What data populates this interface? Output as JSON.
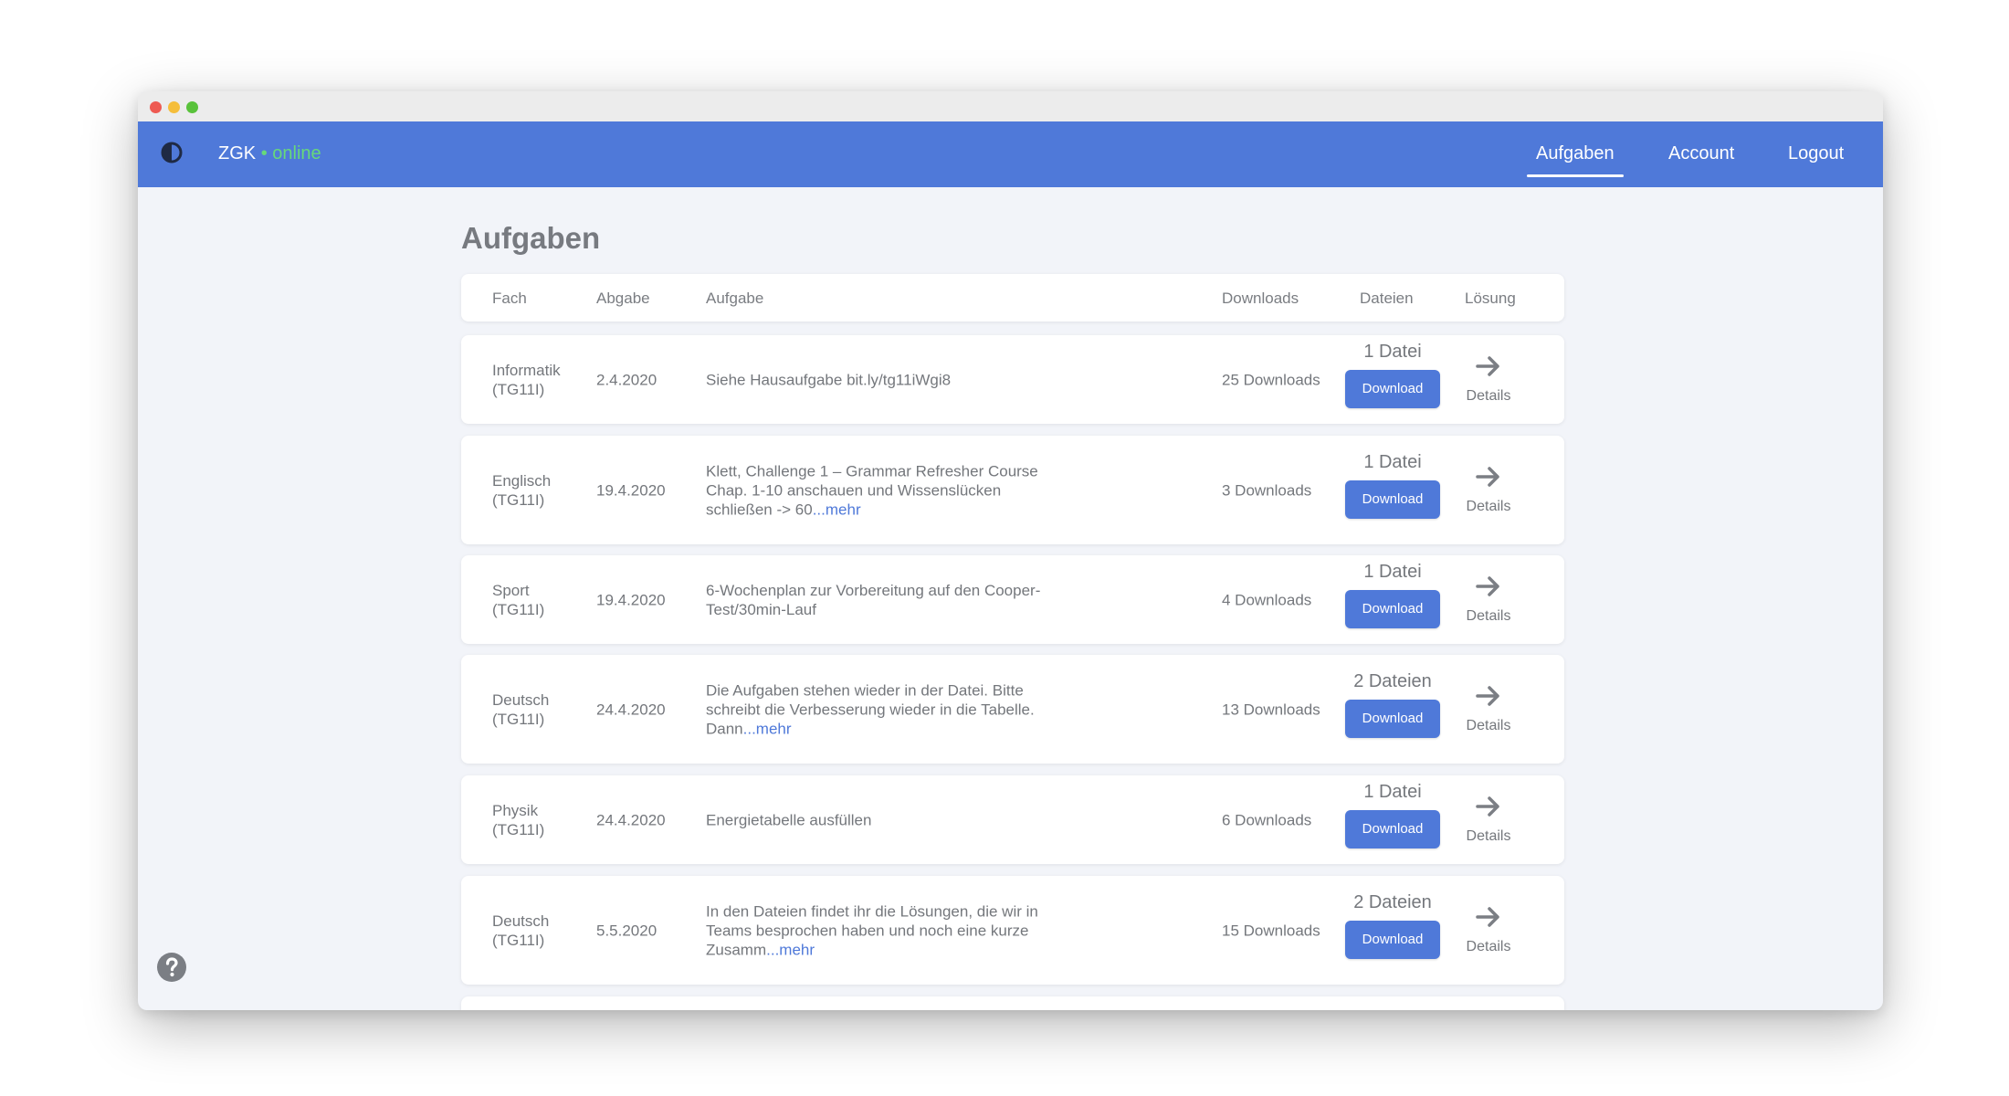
{
  "brand": {
    "name": "ZGK",
    "separator": "•",
    "status": "online"
  },
  "nav": {
    "items": [
      {
        "label": "Aufgaben"
      },
      {
        "label": "Account"
      },
      {
        "label": "Logout"
      }
    ],
    "active": "Aufgaben"
  },
  "page": {
    "title": "Aufgaben"
  },
  "table": {
    "headers": {
      "fach": "Fach",
      "abgabe": "Abgabe",
      "aufgabe": "Aufgabe",
      "downloads": "Downloads",
      "dateien": "Dateien",
      "loesung": "Lösung"
    },
    "rows": [
      {
        "fach": "Informatik",
        "klasse": "(TG11I)",
        "abgabe": "2.4.2020",
        "aufgabe": "Siehe Hausaufgabe bit.ly/tg11iWgi8",
        "mehr": "",
        "downloads": "25 Downloads",
        "dateien": "1 Datei",
        "button": "Download",
        "details": "Details"
      },
      {
        "fach": "Englisch",
        "klasse": "(TG11I)",
        "abgabe": "19.4.2020",
        "aufgabe": "Klett, Challenge 1 – Grammar Refresher Course Chap. 1-10 anschauen und Wissenslücken schließen -> 60",
        "mehr": "...mehr",
        "downloads": "3 Downloads",
        "dateien": "1 Datei",
        "button": "Download",
        "details": "Details"
      },
      {
        "fach": "Sport",
        "klasse": "(TG11I)",
        "abgabe": "19.4.2020",
        "aufgabe": "6-Wochenplan zur Vorbereitung auf den Cooper-Test/30min-Lauf",
        "mehr": "",
        "downloads": "4 Downloads",
        "dateien": "1 Datei",
        "button": "Download",
        "details": "Details"
      },
      {
        "fach": "Deutsch",
        "klasse": "(TG11I)",
        "abgabe": "24.4.2020",
        "aufgabe": "Die Aufgaben stehen wieder in der Datei. Bitte schreibt die Verbesserung wieder in die Tabelle. Dann",
        "mehr": "...mehr",
        "downloads": "13 Downloads",
        "dateien": "2 Dateien",
        "button": "Download",
        "details": "Details"
      },
      {
        "fach": "Physik",
        "klasse": "(TG11I)",
        "abgabe": "24.4.2020",
        "aufgabe": "Energietabelle ausfüllen",
        "mehr": "",
        "downloads": "6 Downloads",
        "dateien": "1 Datei",
        "button": "Download",
        "details": "Details"
      },
      {
        "fach": "Deutsch",
        "klasse": "(TG11I)",
        "abgabe": "5.5.2020",
        "aufgabe": "In den Dateien findet ihr die Lösungen, die wir in Teams besprochen haben und noch eine kurze Zusamm",
        "mehr": "...mehr",
        "downloads": "15 Downloads",
        "dateien": "2 Dateien",
        "button": "Download",
        "details": "Details"
      }
    ]
  },
  "icons": {
    "theme": "contrast-icon",
    "help": "help-circle-icon",
    "details": "arrow-right-icon"
  },
  "colors": {
    "primary": "#4f79d9",
    "online": "#67d97a",
    "background": "#f2f4f9",
    "text": "#74777c"
  }
}
